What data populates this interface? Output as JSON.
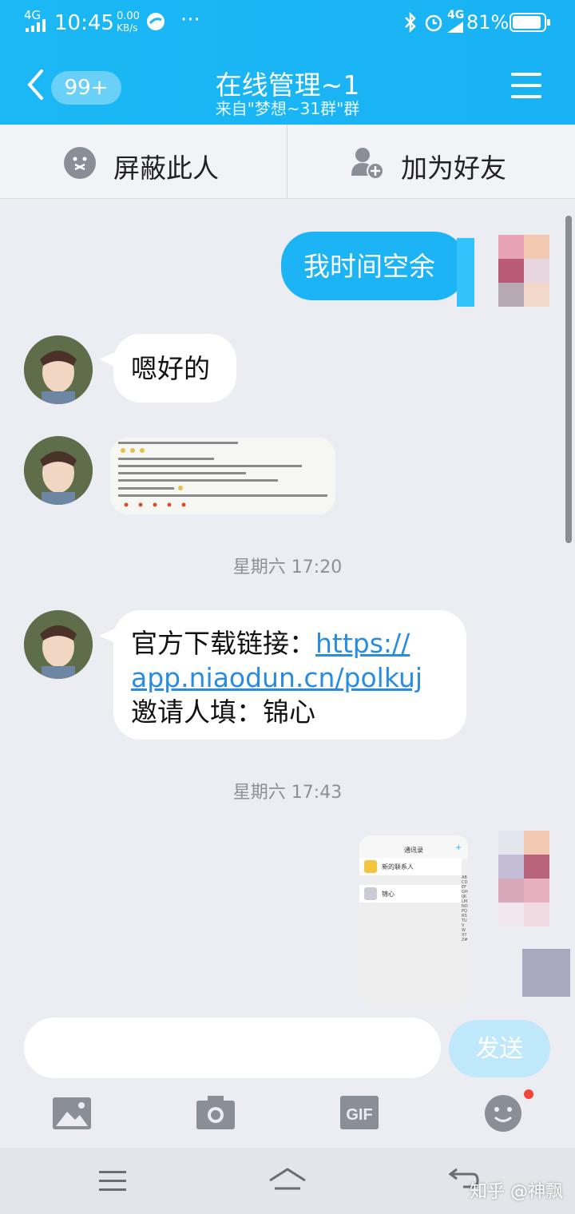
{
  "status_bar": {
    "network": "4G",
    "time": "10:45",
    "speed_top": "0.00",
    "speed_bottom": "KB/s",
    "more": "···",
    "signal_right": "4G",
    "battery": "81%"
  },
  "header": {
    "back_badge": "99+",
    "title": "在线管理~1",
    "subtitle": "来自\"梦想~31群\"群",
    "accent": "#1bb8f5"
  },
  "actions": {
    "block": "屏蔽此人",
    "add_friend": "加为好友"
  },
  "messages": {
    "m1": "我时间空余",
    "m2": "嗯好的",
    "time1": "星期六 17:20",
    "m4_prefix": "官方下载链接：",
    "m4_link": "https://app.niaodun.cn/polkuj",
    "m4_line1_link": "https://",
    "m4_line2_link": "app.niaodun.cn/polkuj",
    "m4_line3": "邀请人填：锦心",
    "time2": "星期六 17:43"
  },
  "screenshot_image": {
    "header_title": "通讯录",
    "row1": "新的联系人",
    "row2": "锦心",
    "alphabet": "ABCDEFGHIJKLMNOPQRSTUVWXYZ#"
  },
  "input": {
    "placeholder": "",
    "send": "发送"
  },
  "watermark": "知乎 @神飘"
}
